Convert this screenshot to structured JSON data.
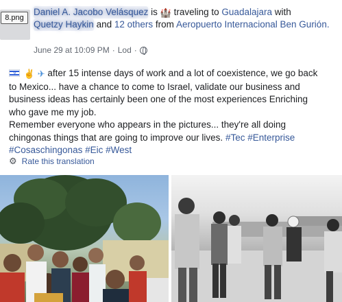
{
  "file_label": "8.png",
  "header": {
    "author_name": "Daniel A. Jacobo Velásquez",
    "is_word": "is",
    "feeling_icon": "city-icon",
    "activity": "traveling to",
    "destination": "Guadalajara",
    "with_word": "with",
    "companion_name": "Quetzy Haykin",
    "and_word": "and",
    "others": "12 others",
    "from_word": "from",
    "origin": "Aeropuerto Internacional Ben Gurión."
  },
  "meta": {
    "timestamp": "June 29 at 10:09 PM",
    "separator": "·",
    "location": "Lod",
    "privacy_icon": "globe-icon"
  },
  "post": {
    "line1_rest": "after 15 intense days of work and a lot of coexistence, we go back",
    "line2": "to Mexico... have a chance to come to Israel, validate our business and",
    "line3": "business ideas has certainly been one of the most experiences Enriching",
    "line4": "who gave me my job.",
    "line5": "Remember everyone who appears in the pictures... they're all doing",
    "line6": "chingonas things that are going to improve our lives.",
    "tags_line6": "#Tec #Enterprise",
    "tags_line7": "#Cosaschingonas #Eic #West",
    "leading_icons": [
      "israel-flag-icon",
      "victory-hand-icon",
      "airplane-icon"
    ]
  },
  "translation": {
    "label": "Rate this translation",
    "icon": "gear-icon"
  },
  "photos": [
    {
      "name": "group-selfie-photo"
    },
    {
      "name": "group-walking-photo"
    }
  ]
}
